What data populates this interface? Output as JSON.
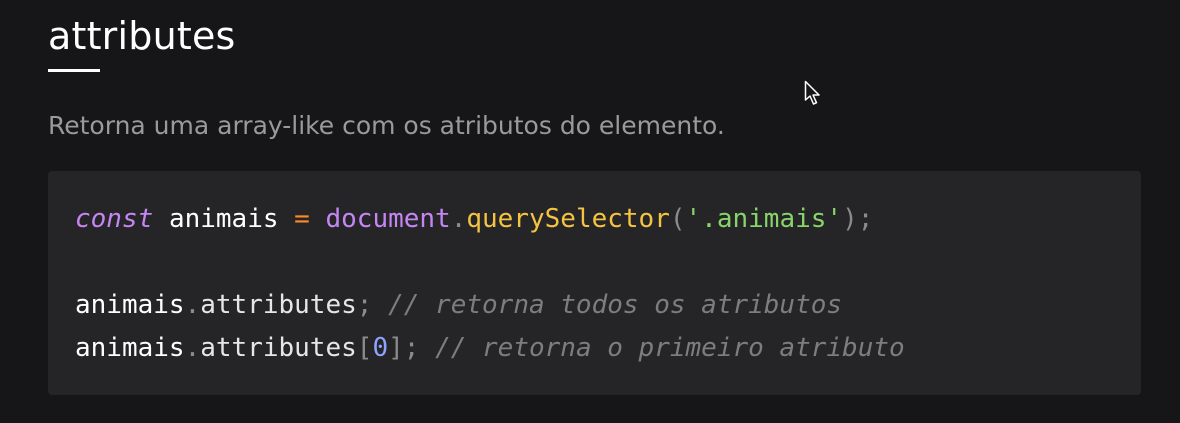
{
  "section": {
    "title": "attributes",
    "description": "Retorna uma array-like com os atributos do elemento."
  },
  "code": {
    "line1": {
      "keyword": "const",
      "variable": "animais",
      "operator": "=",
      "object": "document",
      "dot": ".",
      "method": "querySelector",
      "open_paren": "(",
      "argument": "'.animais'",
      "close_paren": ")",
      "semicolon": ";"
    },
    "line2": {
      "object": "animais",
      "dot": ".",
      "property": "attributes",
      "semicolon": ";",
      "comment": "// retorna todos os atributos"
    },
    "line3": {
      "object": "animais",
      "dot": ".",
      "property": "attributes",
      "open_bracket": "[",
      "index": "0",
      "close_bracket": "]",
      "semicolon": ";",
      "comment": "// retorna o primeiro atributo"
    }
  },
  "icons": {
    "cursor": "mouse-pointer-icon"
  }
}
